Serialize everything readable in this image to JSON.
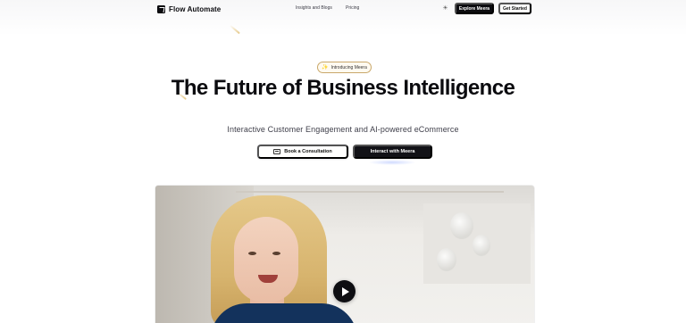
{
  "nav": {
    "brand": "Flow Automate",
    "links": [
      "Insights and Blogs",
      "Pricing"
    ],
    "theme_icon": "sun-icon",
    "explore_label": "Explore Meera",
    "get_started_label": "Get Started"
  },
  "hero": {
    "badge": "Introducing Meera",
    "badge_icon": "sparkle-icon",
    "title": "The Future of Business Intelligence",
    "subtitle": "Interactive Customer Engagement and AI-powered eCommerce",
    "cta_primary": "Book a Consultation",
    "cta_primary_icon": "calendar-icon",
    "cta_secondary": "Interact with Meera"
  },
  "video": {
    "play_icon": "play-icon"
  },
  "colors": {
    "accent_dark": "#0b0b0f",
    "badge_border": "#c9a86a",
    "shirt": "#13325c"
  }
}
